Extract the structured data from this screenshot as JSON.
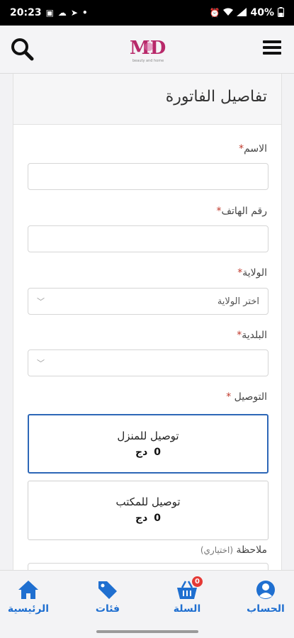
{
  "status_bar": {
    "time": "20:23",
    "battery": "40%"
  },
  "header": {
    "logo_text": "MD",
    "logo_subtitle": "beauty and home"
  },
  "form": {
    "title": "تفاصيل الفاتورة",
    "name_label": "الاسم",
    "phone_label": "رقم الهاتف",
    "wilaya_label": "الولاية",
    "wilaya_value": "اختر الولاية",
    "commune_label": "البلدية",
    "commune_value": "",
    "delivery_label": "التوصيل",
    "required_mark": "*",
    "delivery_options": [
      {
        "title": "توصيل للمنزل",
        "price": "0",
        "currency": "دج",
        "selected": true
      },
      {
        "title": "توصيل للمكتب",
        "price": "0",
        "currency": "دج",
        "selected": false
      }
    ],
    "note_label": "ملاحظة",
    "note_optional": "(اختياري)"
  },
  "bottom_nav": {
    "home": "الرئيسية",
    "categories": "فئات",
    "cart": "السلة",
    "cart_count": "0",
    "account": "الحساب"
  },
  "colors": {
    "accent": "#1f6fd0",
    "selected_border": "#2d67b7",
    "required": "#c0392b",
    "badge": "#e53935"
  }
}
